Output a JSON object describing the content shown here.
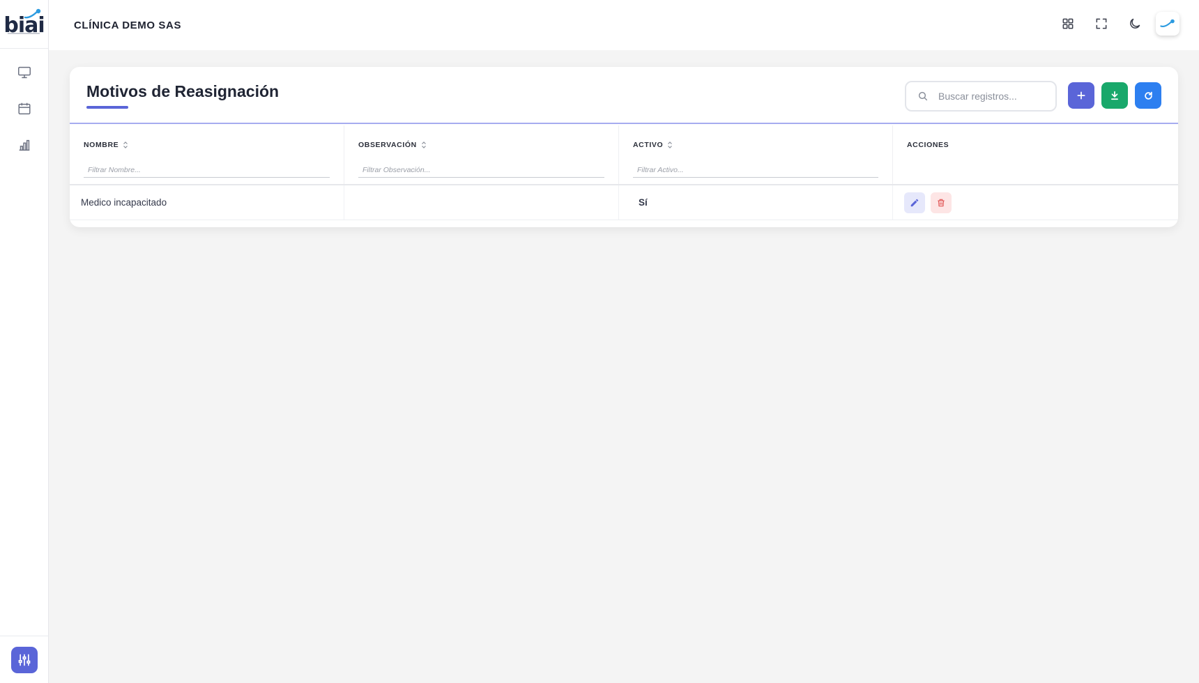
{
  "app": {
    "logo_text": "biai"
  },
  "sidebar": {
    "items": [
      {
        "name": "monitor-icon"
      },
      {
        "name": "calendar-icon"
      },
      {
        "name": "bar-chart-icon"
      }
    ],
    "settings_icon": "sliders-icon"
  },
  "header": {
    "company": "CLÍNICA DEMO SAS",
    "icons": [
      "grid-icon",
      "fullscreen-icon",
      "moon-icon",
      "avatar"
    ]
  },
  "page": {
    "title": "Motivos de Reasignación",
    "search_placeholder": "Buscar registros...",
    "actions": [
      "add-icon",
      "download-icon",
      "refresh-icon"
    ]
  },
  "table": {
    "columns": [
      {
        "label": "NOMBRE",
        "filter_placeholder": "Filtrar Nombre...",
        "sortable": true
      },
      {
        "label": "OBSERVACIÓN",
        "filter_placeholder": "Filtrar Observación...",
        "sortable": true
      },
      {
        "label": "ACTIVO",
        "filter_placeholder": "Filtrar Activo...",
        "sortable": true
      },
      {
        "label": "ACCIONES",
        "filter_placeholder": "",
        "sortable": false
      }
    ],
    "rows": [
      {
        "nombre": "Medico incapacitado",
        "observacion": "",
        "activo": "Sí"
      }
    ]
  },
  "colors": {
    "primary": "#5a65d8",
    "success": "#19a86b",
    "info": "#2d7ff0",
    "danger": "#e05454"
  }
}
